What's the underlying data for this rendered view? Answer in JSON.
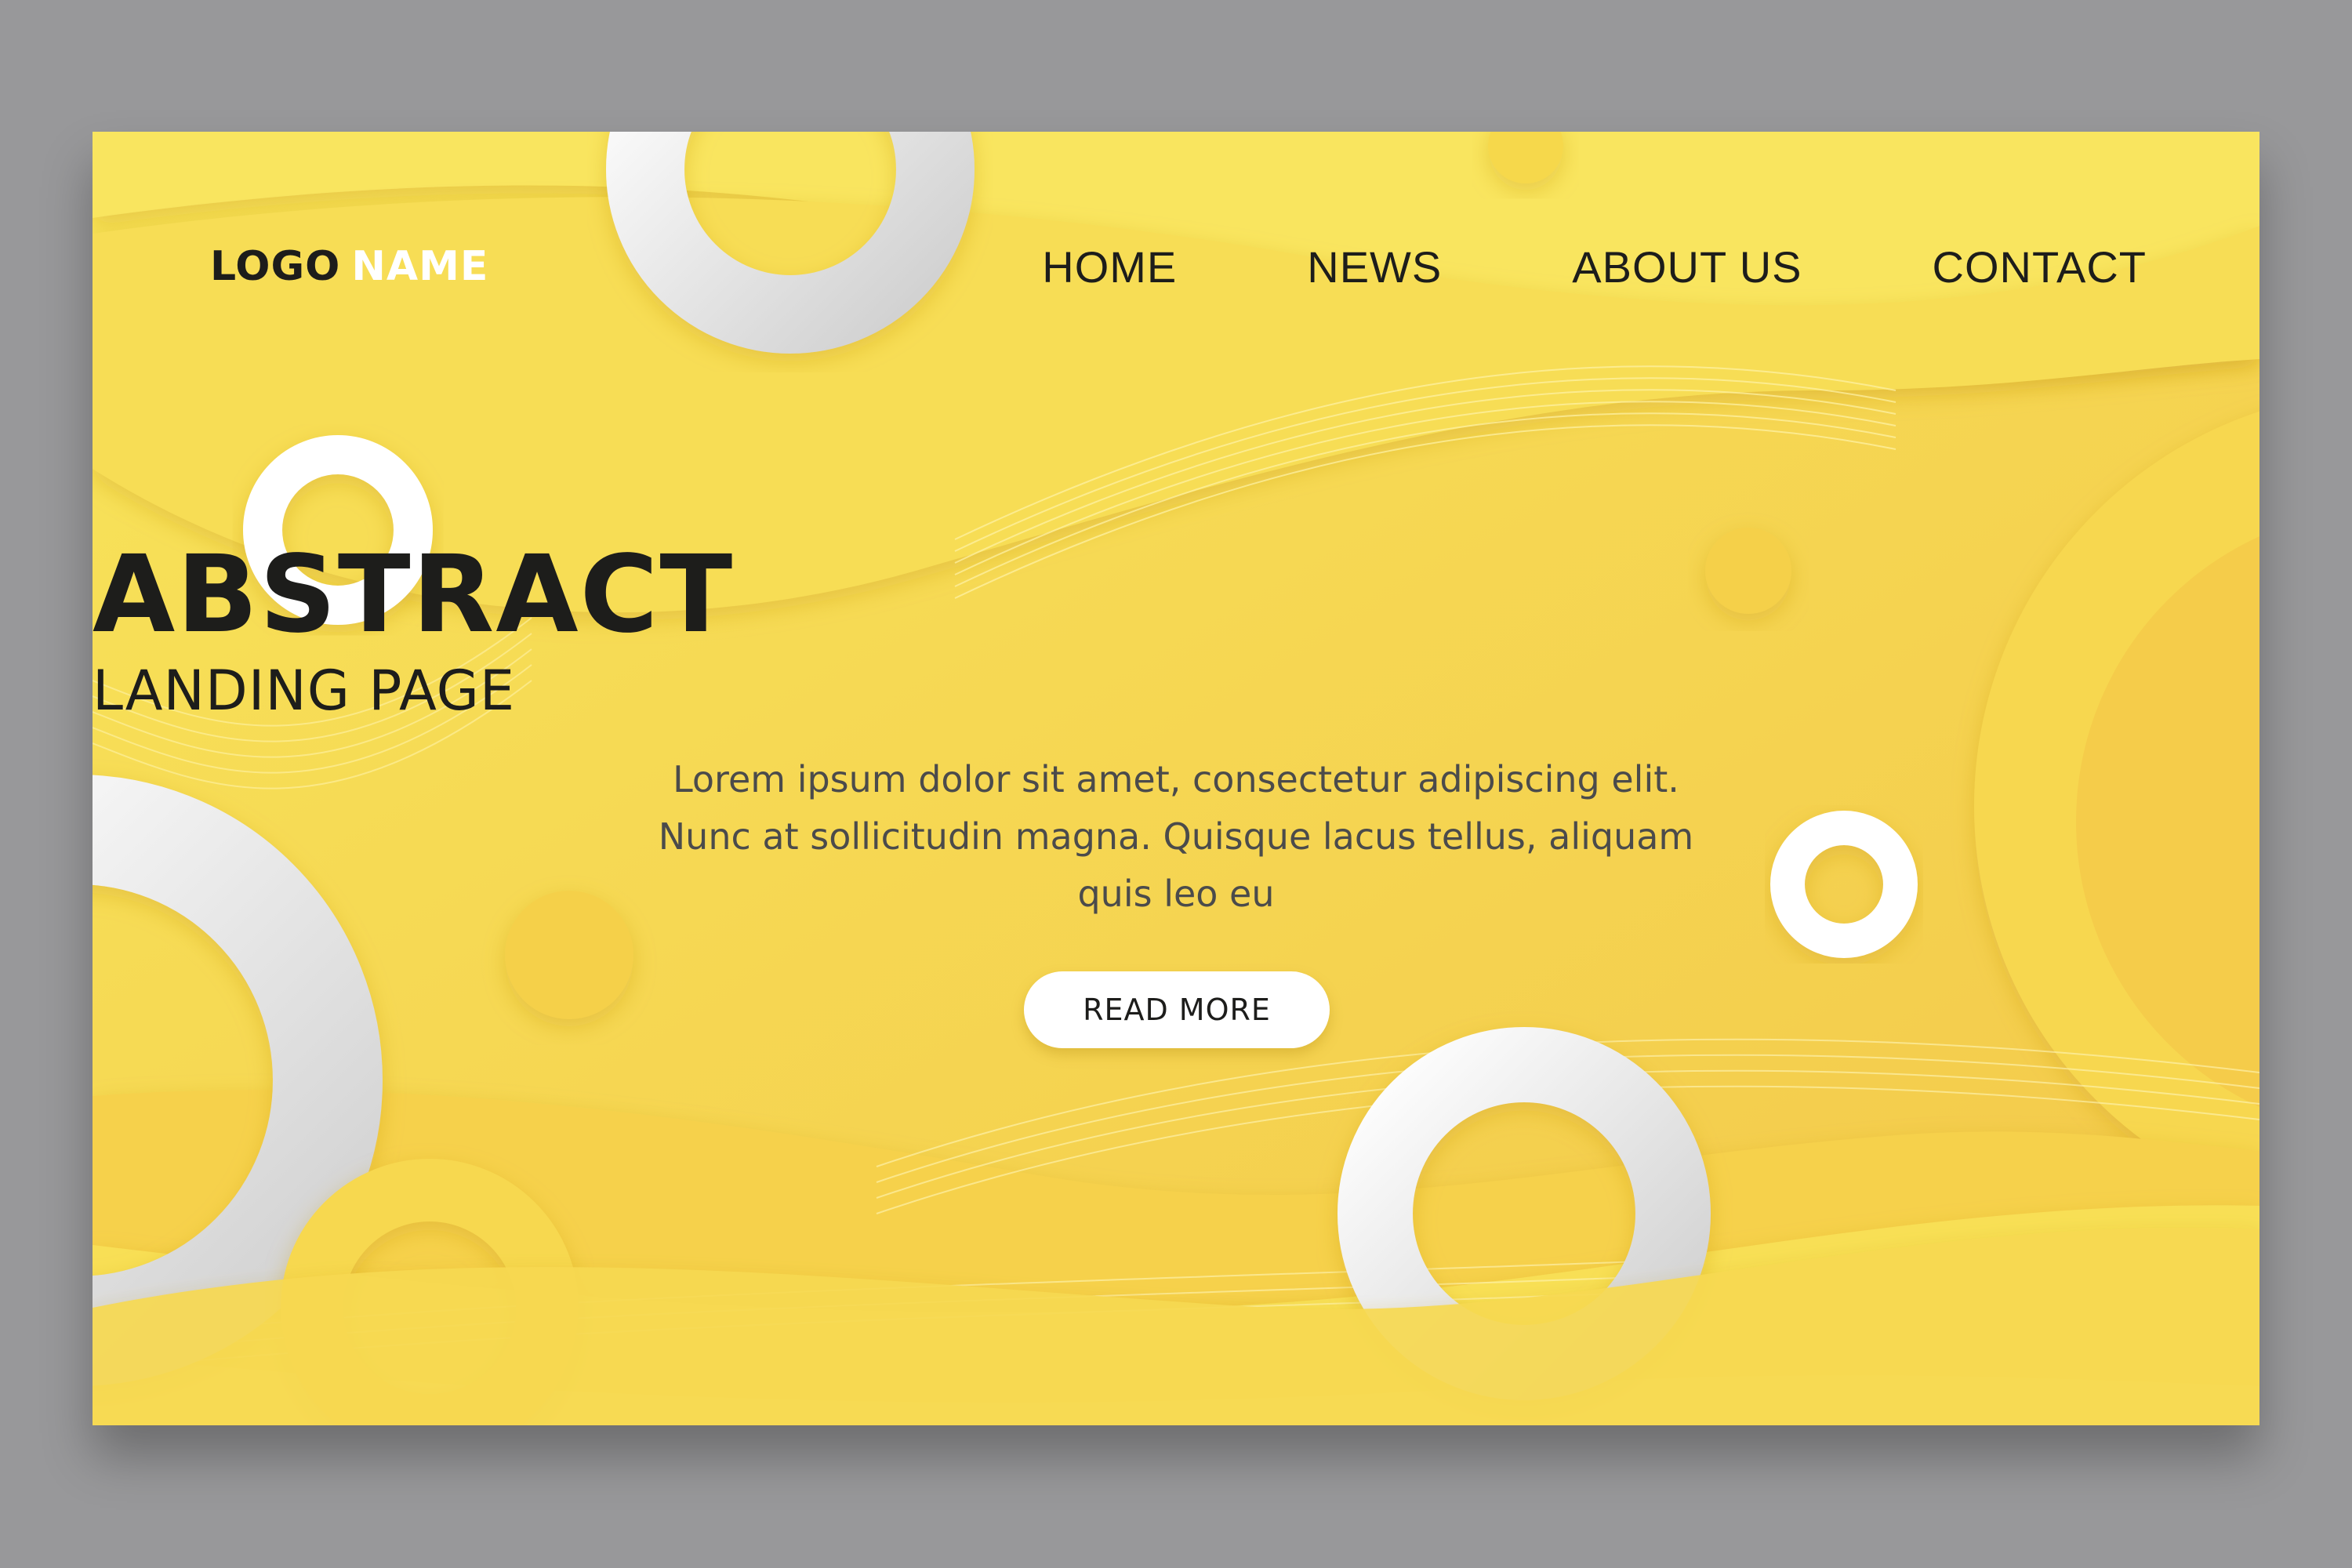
{
  "logo": {
    "part1": "LOGO",
    "part2": "NAME"
  },
  "nav": {
    "items": [
      {
        "label": "HOME"
      },
      {
        "label": "NEWS"
      },
      {
        "label": "ABOUT US"
      },
      {
        "label": "CONTACT"
      }
    ]
  },
  "hero": {
    "title": "ABSTRACT",
    "subtitle": "LANDING PAGE",
    "body": "Lorem ipsum dolor sit amet, consectetur adipiscing elit. Nunc at sollicitudin magna. Quisque lacus tellus, aliquam quis leo eu",
    "cta_label": "READ MORE"
  },
  "colors": {
    "background": "#98989a",
    "page_yellow": "#f6d84a",
    "text_dark": "#1d1d1b",
    "text_body": "#4b4b4b",
    "ring_white": "#ffffff"
  }
}
